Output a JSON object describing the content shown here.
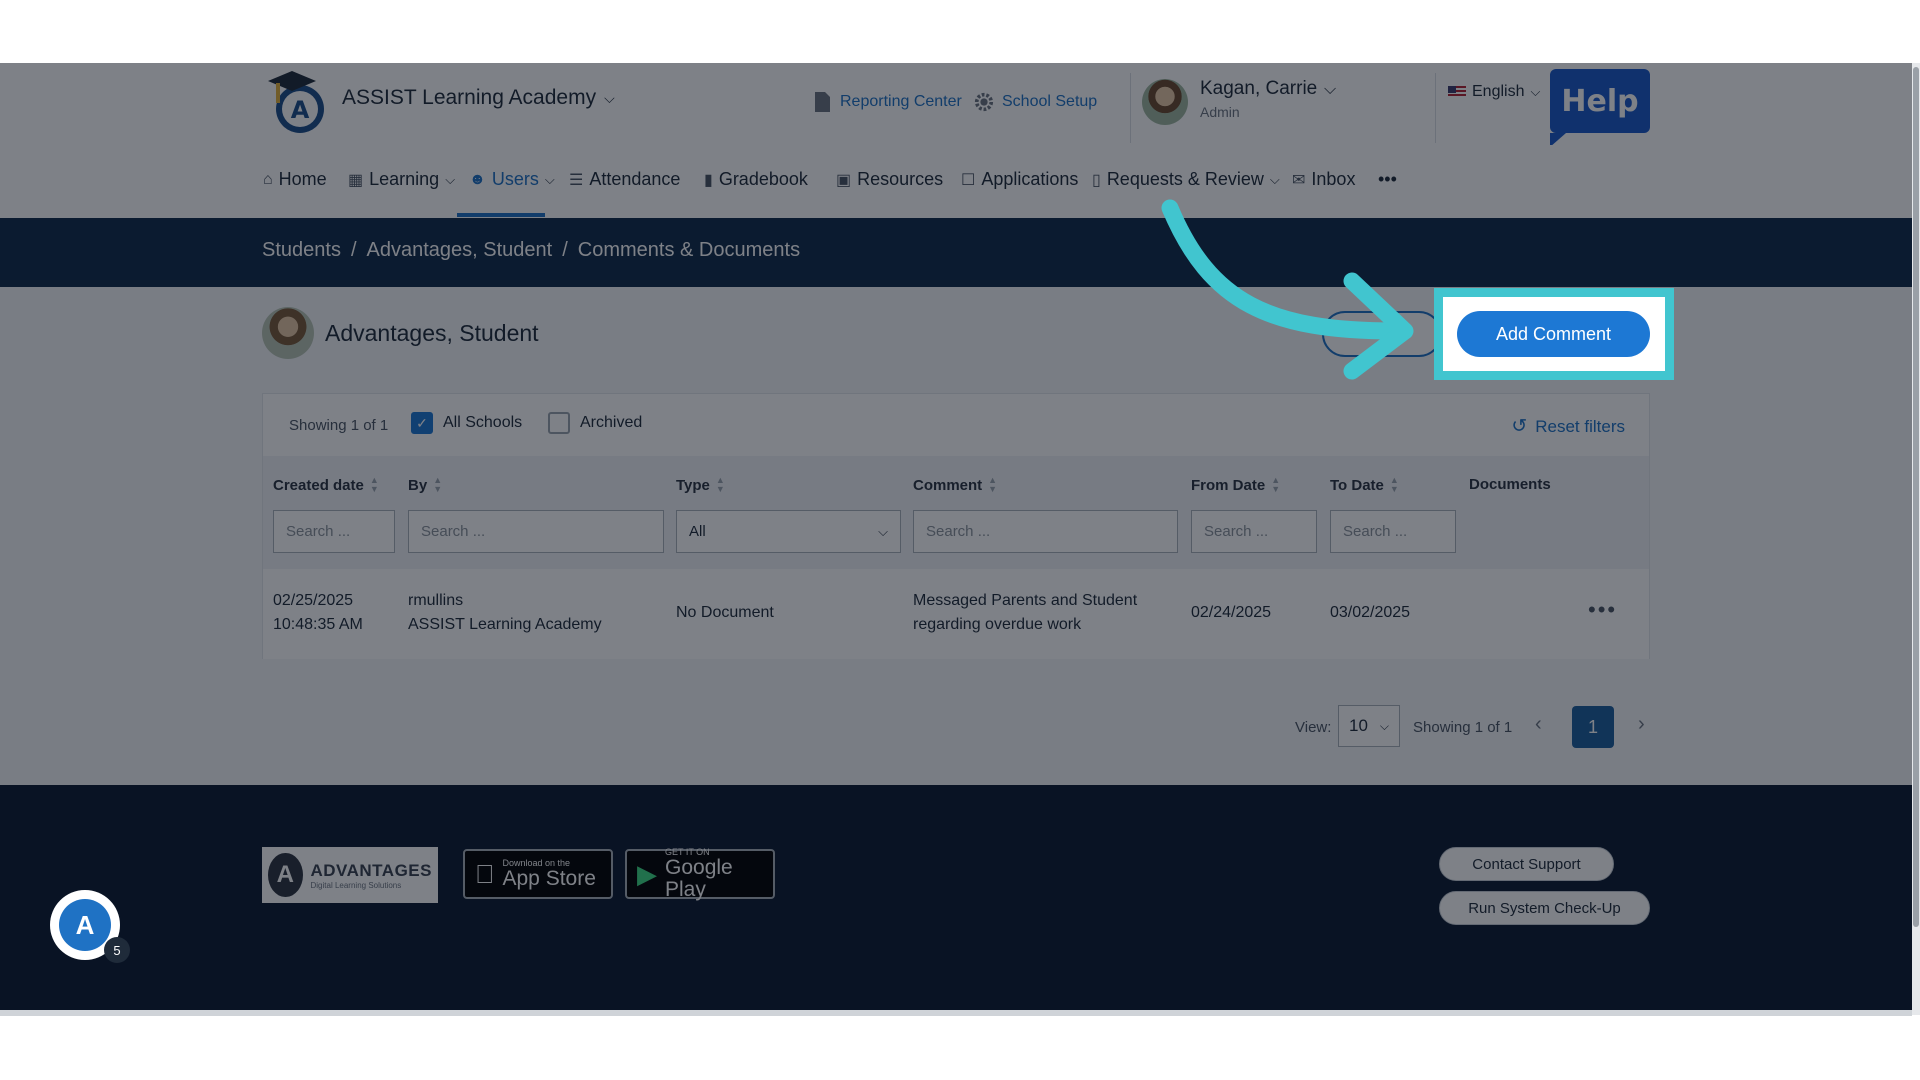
{
  "header": {
    "academy_name": "ASSIST Learning Academy",
    "reporting_center": "Reporting Center",
    "school_setup": "School Setup",
    "user_name": "Kagan, Carrie",
    "user_role": "Admin",
    "language": "English",
    "help": "Help"
  },
  "nav": {
    "home": "Home",
    "learning": "Learning",
    "users": "Users",
    "attendance": "Attendance",
    "gradebook": "Gradebook",
    "resources": "Resources",
    "applications": "Applications",
    "requests_review": "Requests & Review",
    "inbox": "Inbox",
    "more": "•••"
  },
  "breadcrumb": {
    "c1": "Students",
    "c2": "Advantages, Student",
    "c3": "Comments & Documents",
    "sep": "/"
  },
  "student": {
    "name": "Advantages, Student"
  },
  "actions": {
    "add_comment": "Add Comment"
  },
  "filters": {
    "showing": "Showing 1 of 1",
    "all_schools": "All Schools",
    "archived": "Archived",
    "reset": "Reset filters"
  },
  "table": {
    "columns": {
      "created_date": "Created date",
      "by": "By",
      "type": "Type",
      "comment": "Comment",
      "from_date": "From Date",
      "to_date": "To Date",
      "documents": "Documents"
    },
    "search_placeholder": "Search ...",
    "type_selected": "All",
    "rows": [
      {
        "created_date": "02/25/2025",
        "created_time": "10:48:35 AM",
        "by_user": "rmullins",
        "by_school": "ASSIST Learning Academy",
        "type": "No Document",
        "comment_line1": "Messaged Parents and Student",
        "comment_line2": "regarding overdue work",
        "from_date": "02/24/2025",
        "to_date": "03/02/2025"
      }
    ]
  },
  "pagination": {
    "view_label": "View:",
    "view_value": "10",
    "showing": "Showing 1 of 1",
    "current_page": "1"
  },
  "footer": {
    "brand_main": "ADVANTAGES",
    "brand_sub": "Digital Learning Solutions",
    "appstore_small": "Download on the",
    "appstore_big": "App Store",
    "googleplay_small": "GET IT ON",
    "googleplay_big": "Google Play",
    "contact_support": "Contact Support",
    "system_checkup": "Run System Check-Up",
    "chat_badge": "5"
  },
  "colors": {
    "accent": "#1d78d4",
    "highlight": "#41c5cf",
    "band": "#0f2a49",
    "footer": "#0b1b30"
  }
}
